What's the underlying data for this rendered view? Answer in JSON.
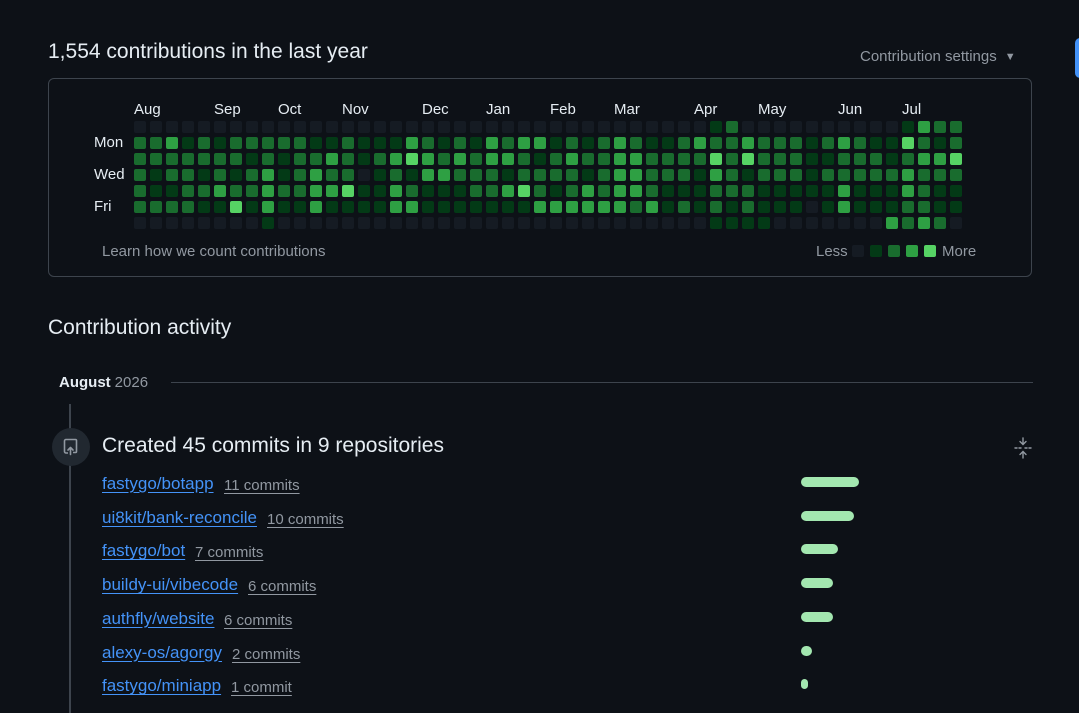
{
  "header": {
    "title": "1,554 contributions in the last year",
    "settings_label": "Contribution settings"
  },
  "graph": {
    "months": [
      {
        "label": "Aug",
        "col": 0
      },
      {
        "label": "Sep",
        "col": 5
      },
      {
        "label": "Oct",
        "col": 9
      },
      {
        "label": "Nov",
        "col": 13
      },
      {
        "label": "Dec",
        "col": 18
      },
      {
        "label": "Jan",
        "col": 22
      },
      {
        "label": "Feb",
        "col": 26
      },
      {
        "label": "Mar",
        "col": 30
      },
      {
        "label": "Apr",
        "col": 35
      },
      {
        "label": "May",
        "col": 39
      },
      {
        "label": "Jun",
        "col": 44
      },
      {
        "label": "Jul",
        "col": 48
      }
    ],
    "days": [
      "Mon",
      "Wed",
      "Fri"
    ],
    "levels_colors": [
      "#151b23",
      "#033a16",
      "#196c2e",
      "#2ea043",
      "#56d364"
    ],
    "weeks": [
      [
        0,
        2,
        2,
        2,
        2,
        2,
        0
      ],
      [
        0,
        2,
        2,
        1,
        1,
        2,
        0
      ],
      [
        0,
        3,
        2,
        2,
        1,
        2,
        0
      ],
      [
        0,
        1,
        2,
        2,
        2,
        2,
        0
      ],
      [
        0,
        2,
        2,
        1,
        2,
        1,
        0
      ],
      [
        0,
        1,
        2,
        2,
        3,
        1,
        0
      ],
      [
        0,
        2,
        2,
        1,
        2,
        4,
        0
      ],
      [
        0,
        2,
        1,
        2,
        2,
        1,
        0
      ],
      [
        0,
        2,
        2,
        3,
        3,
        3,
        1
      ],
      [
        0,
        2,
        1,
        1,
        2,
        1,
        0
      ],
      [
        0,
        2,
        2,
        2,
        2,
        1,
        0
      ],
      [
        0,
        1,
        2,
        3,
        3,
        3,
        0
      ],
      [
        0,
        1,
        3,
        2,
        3,
        1,
        0
      ],
      [
        0,
        2,
        2,
        2,
        4,
        1,
        0
      ],
      [
        0,
        1,
        1,
        0,
        1,
        1,
        0
      ],
      [
        0,
        1,
        2,
        1,
        1,
        1,
        0
      ],
      [
        0,
        1,
        3,
        2,
        3,
        3,
        0
      ],
      [
        0,
        3,
        4,
        1,
        2,
        3,
        0
      ],
      [
        0,
        2,
        3,
        3,
        1,
        1,
        0
      ],
      [
        0,
        1,
        2,
        3,
        1,
        1,
        0
      ],
      [
        0,
        2,
        3,
        2,
        1,
        1,
        0
      ],
      [
        0,
        1,
        2,
        2,
        2,
        1,
        0
      ],
      [
        0,
        3,
        3,
        2,
        2,
        1,
        0
      ],
      [
        0,
        2,
        3,
        1,
        3,
        1,
        0
      ],
      [
        0,
        3,
        2,
        2,
        4,
        1,
        0
      ],
      [
        0,
        3,
        1,
        2,
        2,
        3,
        0
      ],
      [
        0,
        1,
        2,
        2,
        1,
        3,
        0
      ],
      [
        0,
        2,
        3,
        2,
        2,
        3,
        0
      ],
      [
        0,
        1,
        2,
        1,
        3,
        3,
        0
      ],
      [
        0,
        2,
        2,
        2,
        2,
        3,
        0
      ],
      [
        0,
        3,
        3,
        3,
        3,
        3,
        0
      ],
      [
        0,
        2,
        3,
        3,
        3,
        2,
        0
      ],
      [
        0,
        1,
        2,
        2,
        2,
        3,
        0
      ],
      [
        0,
        1,
        2,
        2,
        1,
        1,
        0
      ],
      [
        0,
        2,
        2,
        2,
        1,
        2,
        0
      ],
      [
        0,
        3,
        2,
        1,
        1,
        1,
        0
      ],
      [
        1,
        2,
        4,
        3,
        2,
        2,
        1
      ],
      [
        2,
        2,
        2,
        2,
        2,
        1,
        1
      ],
      [
        0,
        3,
        4,
        1,
        2,
        2,
        1
      ],
      [
        0,
        2,
        2,
        2,
        1,
        1,
        1
      ],
      [
        0,
        2,
        2,
        2,
        1,
        1,
        0
      ],
      [
        0,
        2,
        2,
        2,
        1,
        1,
        0
      ],
      [
        0,
        1,
        1,
        1,
        1,
        0,
        0
      ],
      [
        0,
        2,
        1,
        2,
        1,
        1,
        0
      ],
      [
        0,
        3,
        2,
        2,
        3,
        3,
        0
      ],
      [
        0,
        2,
        2,
        2,
        1,
        1,
        0
      ],
      [
        0,
        1,
        2,
        2,
        1,
        1,
        0
      ],
      [
        0,
        1,
        1,
        2,
        1,
        1,
        3
      ],
      [
        1,
        4,
        2,
        3,
        3,
        2,
        2
      ],
      [
        3,
        2,
        3,
        2,
        2,
        2,
        3
      ],
      [
        2,
        1,
        3,
        2,
        1,
        1,
        2
      ],
      [
        2,
        2,
        4,
        2,
        1,
        1,
        0
      ]
    ],
    "learn_link": "Learn how we count contributions",
    "legend_less": "Less",
    "legend_more": "More"
  },
  "activity": {
    "title": "Contribution activity",
    "month": "August",
    "year": "2026",
    "created_title": "Created 45 commits in 9 repositories",
    "repos": [
      {
        "name": "fastygo/botapp",
        "count": "11 commits",
        "commits": 11
      },
      {
        "name": "ui8kit/bank-reconcile",
        "count": "10 commits",
        "commits": 10
      },
      {
        "name": "fastygo/bot",
        "count": "7 commits",
        "commits": 7
      },
      {
        "name": "buildy-ui/vibecode",
        "count": "6 commits",
        "commits": 6
      },
      {
        "name": "authfly/website",
        "count": "6 commits",
        "commits": 6
      },
      {
        "name": "alexy-os/agorgy",
        "count": "2 commits",
        "commits": 2
      },
      {
        "name": "fastygo/miniapp",
        "count": "1 commit",
        "commits": 1
      }
    ],
    "bar_color": "#a3e7b0"
  }
}
